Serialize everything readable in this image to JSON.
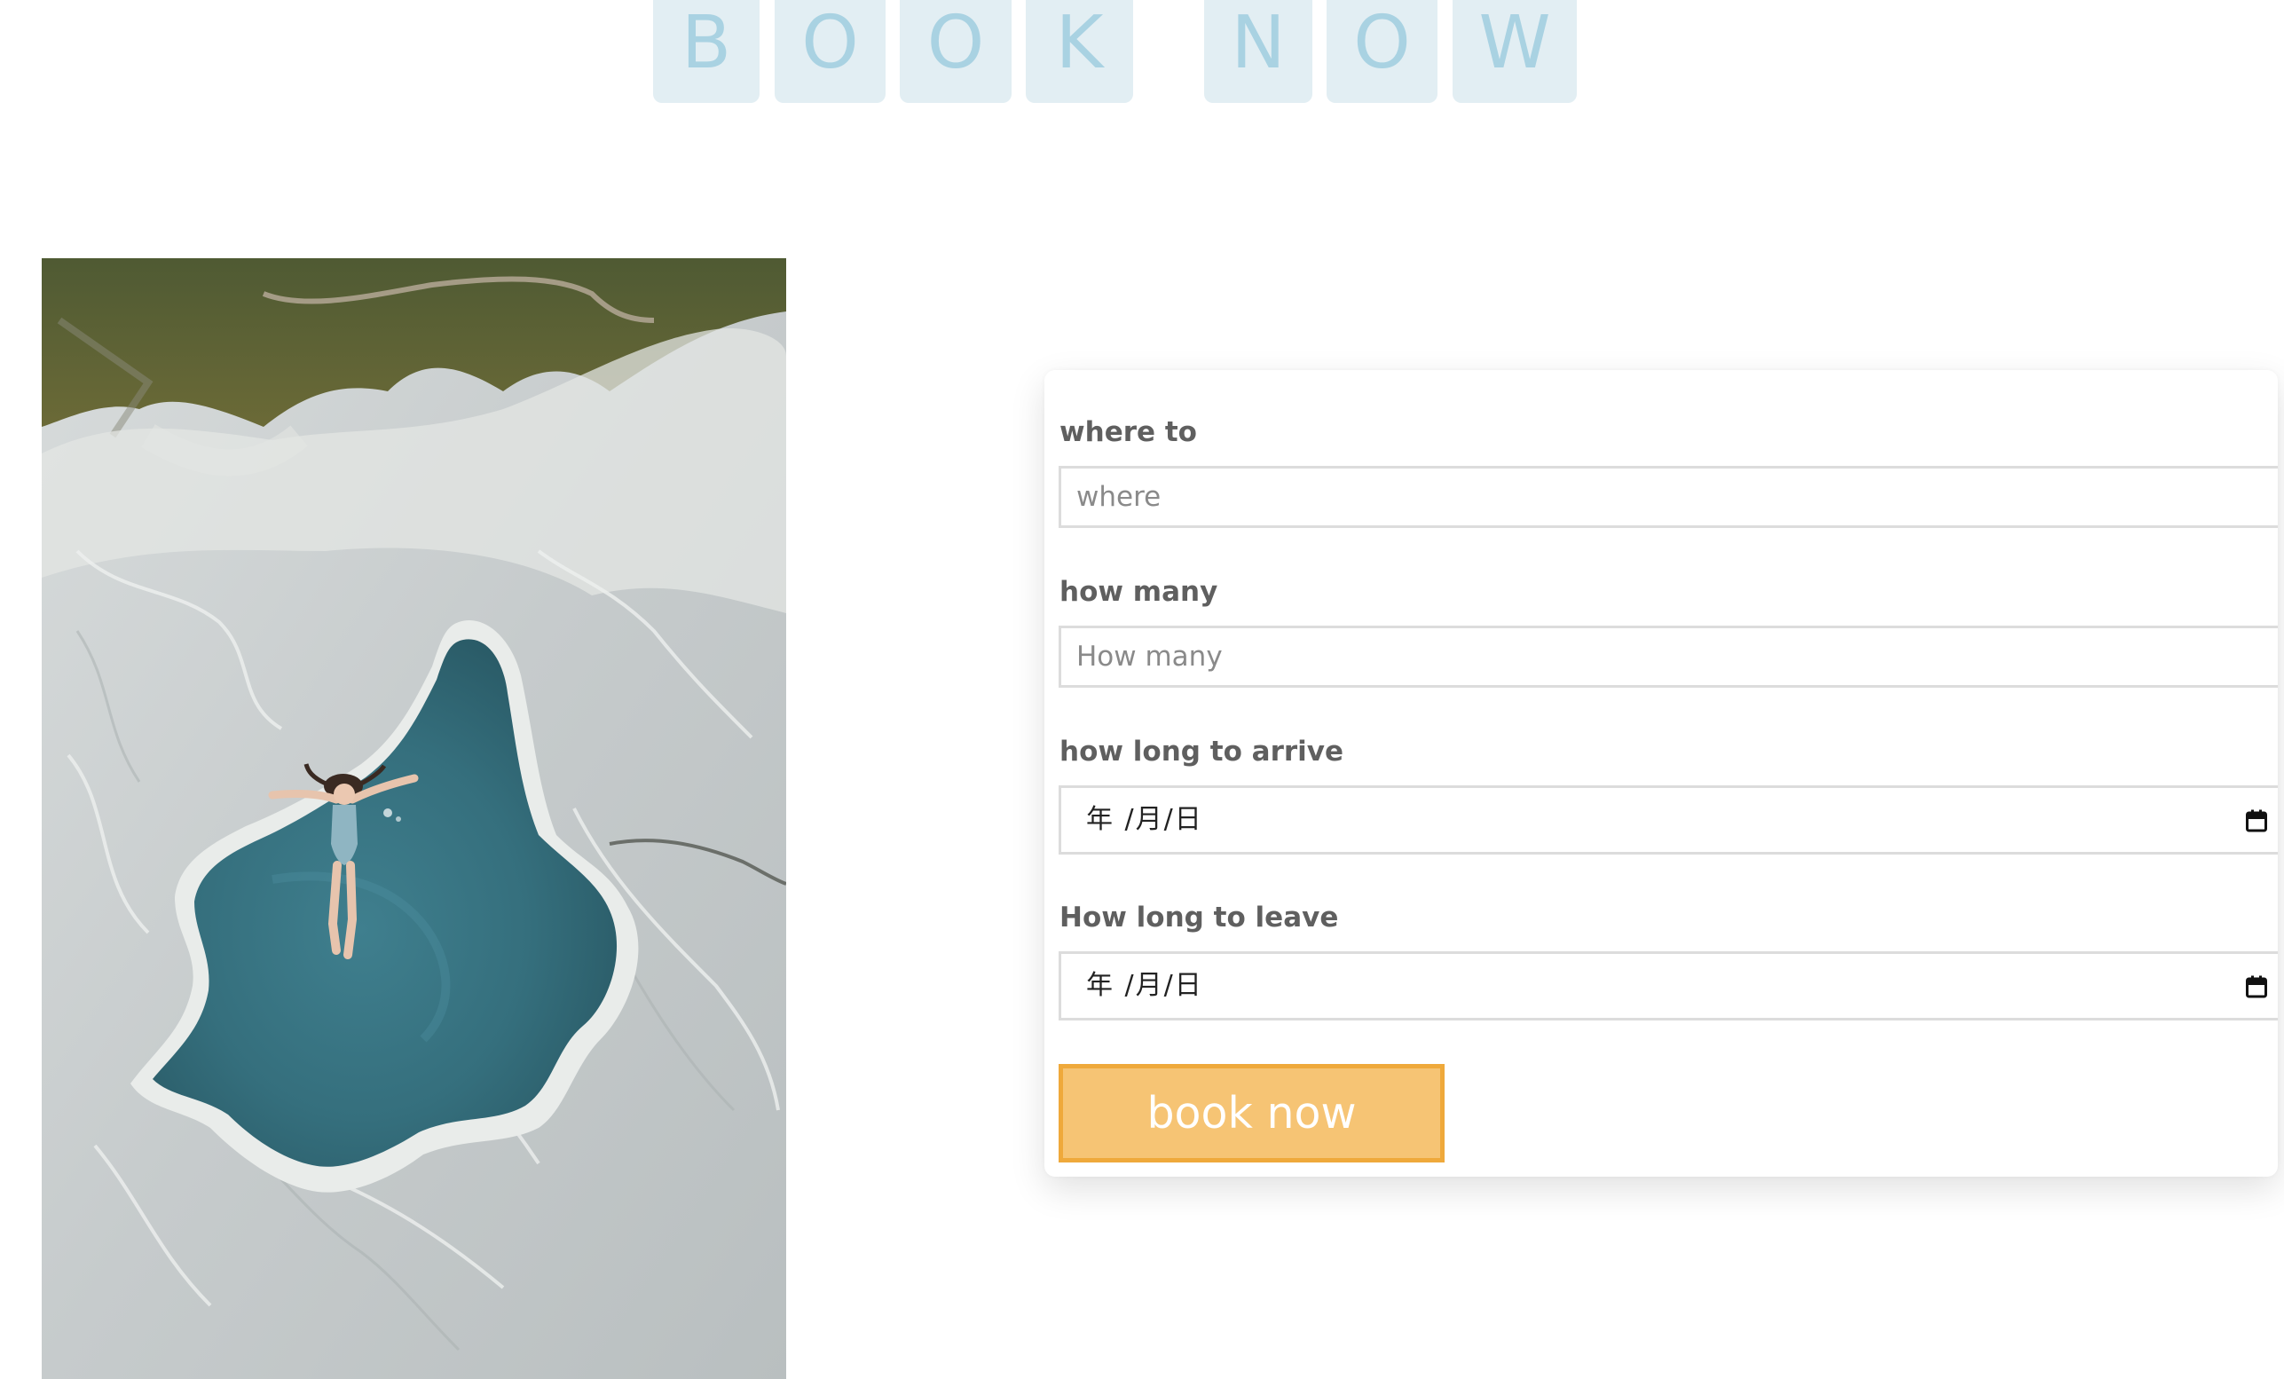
{
  "heading": {
    "letters": [
      "B",
      "O",
      "O",
      "K",
      "N",
      "O",
      "W"
    ]
  },
  "photo": {
    "subject": "aerial-hot-spring-swimmer-image"
  },
  "form": {
    "where": {
      "label": "where to",
      "placeholder": "where"
    },
    "how_many": {
      "label": "how many",
      "placeholder": "How many"
    },
    "arrive": {
      "label": "how long to arrive",
      "placeholder": "年 /月/日"
    },
    "leave": {
      "label": "How long to leave",
      "placeholder": "年 /月/日"
    },
    "submit_label": "book now"
  },
  "colors": {
    "tile_background": "#e2eef3",
    "tile_text": "#a9d2e2",
    "button_fill": "#f6c474",
    "button_border": "#efa93b",
    "label_text": "#5f5f5f"
  }
}
